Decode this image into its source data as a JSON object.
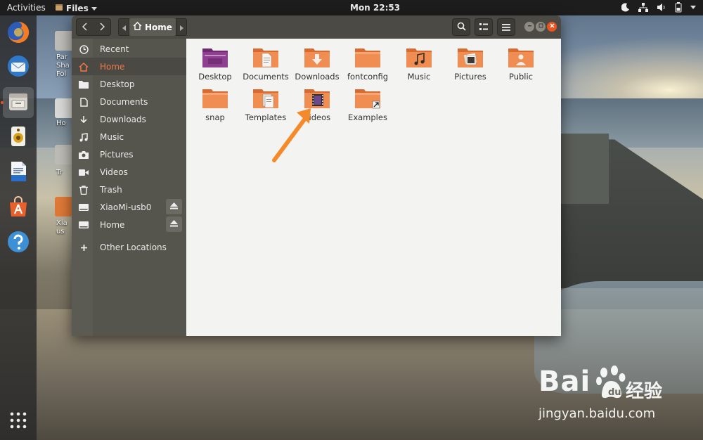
{
  "topbar": {
    "activities": "Activities",
    "app_menu": "Files",
    "clock": "Mon 22:53"
  },
  "desktop": {
    "items": [
      {
        "label": "Par Sha Fol"
      },
      {
        "label": "Ho"
      },
      {
        "label": "Tr"
      },
      {
        "label": "Xia us"
      }
    ]
  },
  "window": {
    "path": "Home",
    "sidebar": [
      {
        "label": "Recent",
        "icon": "clock-icon"
      },
      {
        "label": "Home",
        "icon": "home-icon",
        "selected": true
      },
      {
        "label": "Desktop",
        "icon": "folder-icon"
      },
      {
        "label": "Documents",
        "icon": "document-icon"
      },
      {
        "label": "Downloads",
        "icon": "download-icon"
      },
      {
        "label": "Music",
        "icon": "music-icon"
      },
      {
        "label": "Pictures",
        "icon": "camera-icon"
      },
      {
        "label": "Videos",
        "icon": "video-icon"
      },
      {
        "label": "Trash",
        "icon": "trash-icon"
      },
      {
        "label": "XiaoMi-usb0",
        "icon": "drive-icon",
        "eject": true
      },
      {
        "label": "Home",
        "icon": "drive-icon",
        "eject": true
      },
      {
        "label": "Other Locations",
        "icon": "plus-icon"
      }
    ],
    "files": [
      {
        "label": "Desktop",
        "type": "desktop"
      },
      {
        "label": "Documents",
        "type": "documents"
      },
      {
        "label": "Downloads",
        "type": "downloads"
      },
      {
        "label": "fontconfig",
        "type": "plain"
      },
      {
        "label": "Music",
        "type": "music"
      },
      {
        "label": "Pictures",
        "type": "pictures"
      },
      {
        "label": "Public",
        "type": "public"
      },
      {
        "label": "snap",
        "type": "plain"
      },
      {
        "label": "Templates",
        "type": "templates"
      },
      {
        "label": "Videos",
        "type": "videos"
      },
      {
        "label": "Examples",
        "type": "link"
      }
    ]
  },
  "watermark": {
    "logo_text": "Bai",
    "chinese": "经验",
    "url": "jingyan.baidu.com"
  },
  "colors": {
    "accent": "#e95420",
    "folder": "#f08d52",
    "folder_dark": "#d86a30",
    "desktop_folder": "#8f3f90",
    "arrow": "#f58a2a"
  }
}
